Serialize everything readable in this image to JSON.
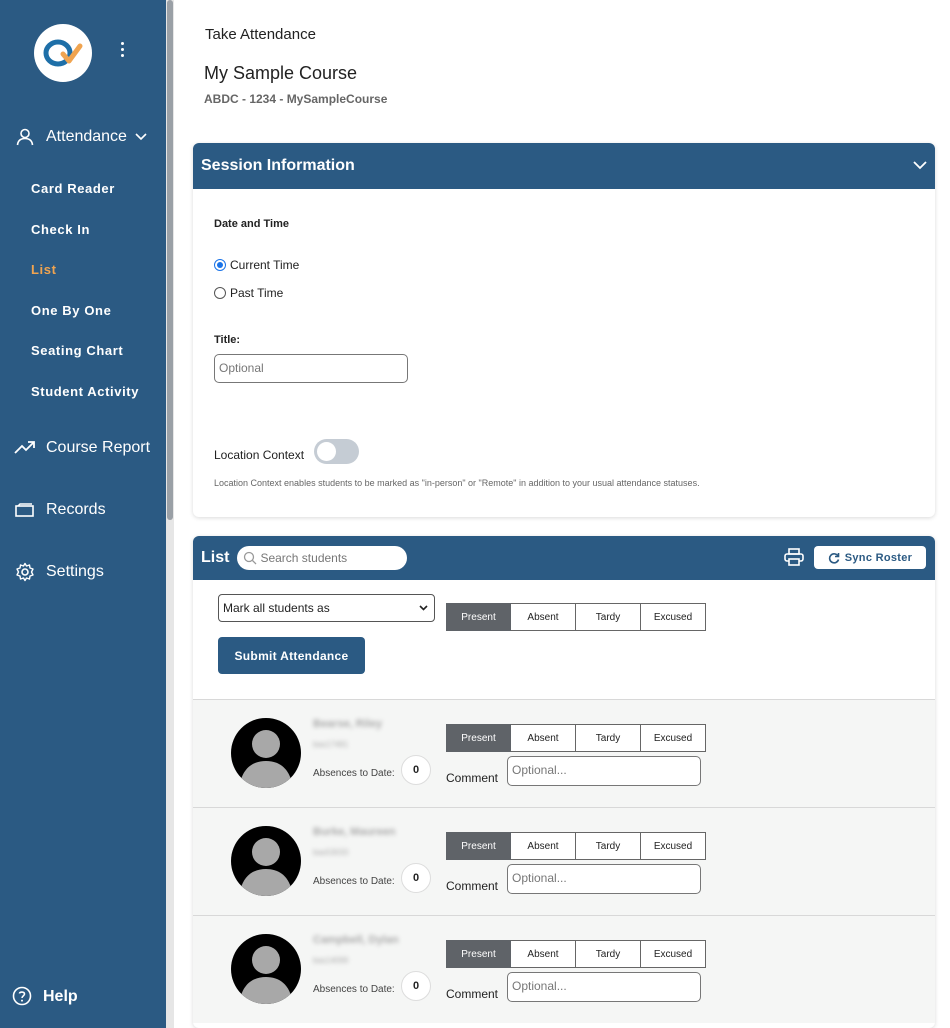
{
  "sidebar": {
    "attendance_label": "Attendance",
    "sub_items": [
      {
        "label": "Card Reader"
      },
      {
        "label": "Check In"
      },
      {
        "label": "List"
      },
      {
        "label": "One By One"
      },
      {
        "label": "Seating Chart"
      },
      {
        "label": "Student Activity"
      }
    ],
    "active_item": "List",
    "course_report_label": "Course Report",
    "records_label": "Records",
    "settings_label": "Settings",
    "help_label": "Help"
  },
  "header": {
    "breadcrumb": "Take Attendance",
    "course_title": "My Sample Course",
    "course_code": "ABDC - 1234 - MySampleCourse"
  },
  "session": {
    "heading": "Session Information",
    "date_time_label": "Date and Time",
    "radio_current": "Current Time",
    "radio_past": "Past Time",
    "selected": "Current Time",
    "title_label": "Title:",
    "title_placeholder": "Optional",
    "location_label": "Location Context",
    "location_enabled": false,
    "location_desc": "Location Context enables students to be marked as \"in-person\" or \"Remote\" in addition to your usual attendance statuses."
  },
  "list": {
    "heading": "List",
    "search_placeholder": "Search students",
    "sync_label": "Sync Roster",
    "mark_all_label": "Mark all students as",
    "statuses": [
      "Present",
      "Absent",
      "Tardy",
      "Excused"
    ],
    "selected_status": "Present",
    "submit_label": "Submit Attendance",
    "absences_label": "Absences to Date:",
    "comment_label": "Comment",
    "comment_placeholder": "Optional...",
    "students": [
      {
        "name": "Bearse, Riley",
        "id": "bas17481",
        "absences": "0",
        "status": "Present"
      },
      {
        "name": "Burke, Maureen",
        "id": "bas53033",
        "absences": "0",
        "status": "Present"
      },
      {
        "name": "Campbell, Dylan",
        "id": "bas14099",
        "absences": "0",
        "status": "Present"
      }
    ]
  },
  "colors": {
    "primary": "#2b5a83",
    "active_nav": "#f0a450",
    "selected_segment": "#5f6368"
  }
}
